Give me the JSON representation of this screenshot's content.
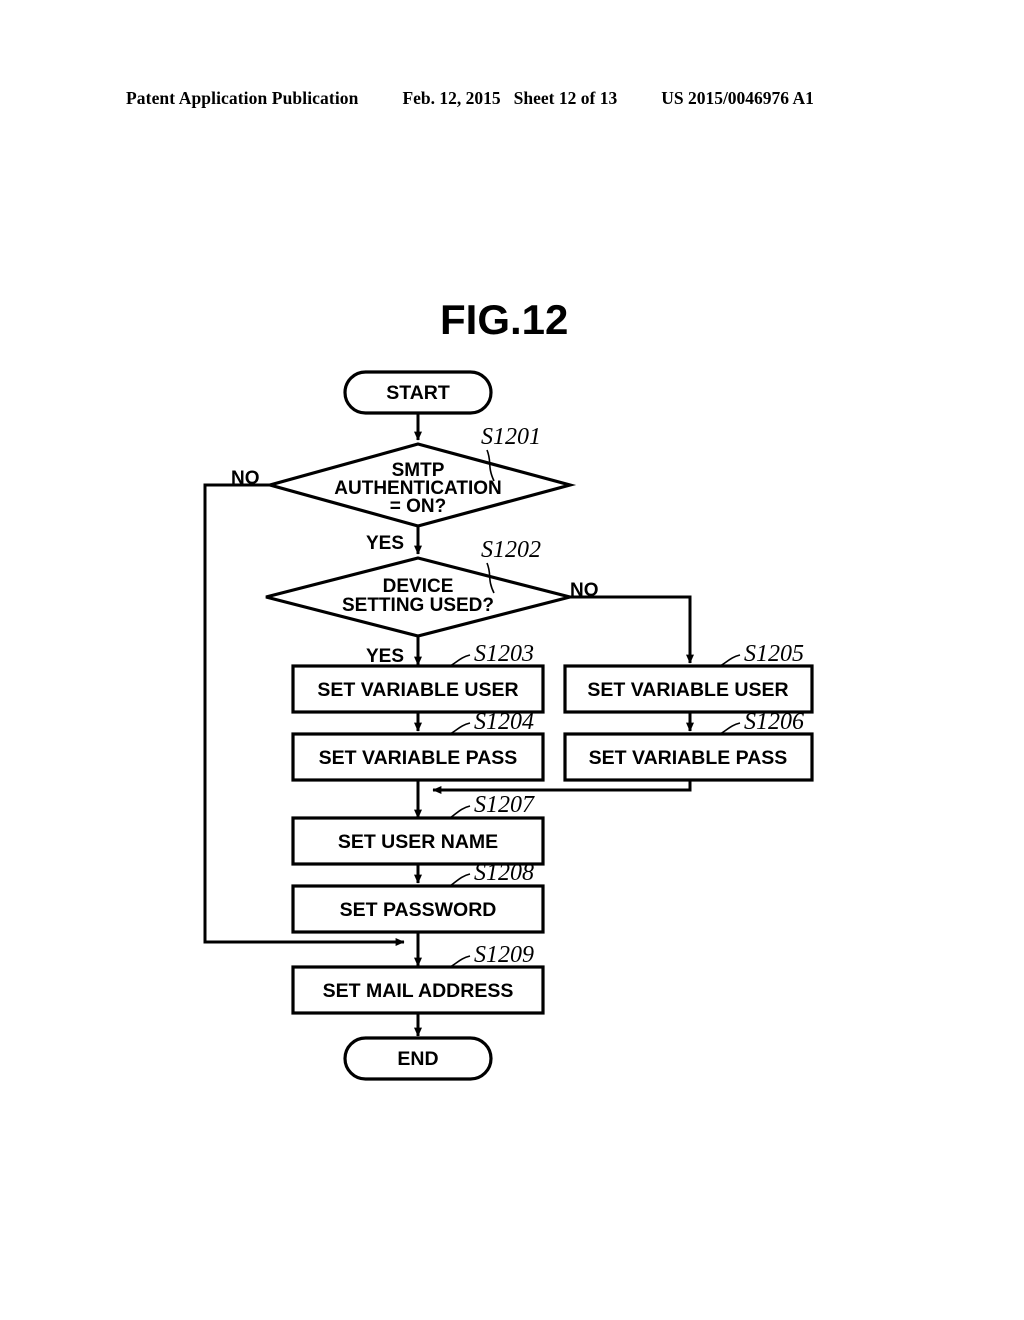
{
  "header": {
    "publication": "Patent Application Publication",
    "date": "Feb. 12, 2015",
    "sheet": "Sheet 12 of 13",
    "patent_number": "US 2015/0046976 A1"
  },
  "figure": {
    "title": "FIG.12"
  },
  "flow": {
    "start_label": "START",
    "end_label": "END",
    "decisions": [
      {
        "id": "S1201",
        "step_label": "S1201",
        "lines": [
          "SMTP",
          "AUTHENTICATION",
          "= ON?"
        ],
        "no_label": "NO",
        "yes_label": "YES"
      },
      {
        "id": "S1202",
        "step_label": "S1202",
        "lines": [
          "DEVICE",
          "SETTING USED?"
        ],
        "no_label": "NO",
        "yes_label": "YES"
      }
    ],
    "processes": [
      {
        "id": "S1203",
        "step_label": "S1203",
        "label": "SET VARIABLE USER"
      },
      {
        "id": "S1204",
        "step_label": "S1204",
        "label": "SET VARIABLE PASS"
      },
      {
        "id": "S1205",
        "step_label": "S1205",
        "label": "SET VARIABLE USER"
      },
      {
        "id": "S1206",
        "step_label": "S1206",
        "label": "SET VARIABLE PASS"
      },
      {
        "id": "S1207",
        "step_label": "S1207",
        "label": "SET USER NAME"
      },
      {
        "id": "S1208",
        "step_label": "S1208",
        "label": "SET PASSWORD"
      },
      {
        "id": "S1209",
        "step_label": "S1209",
        "label": "SET MAIL ADDRESS"
      }
    ]
  },
  "colors": {
    "ink": "#000000",
    "paper": "#ffffff"
  }
}
